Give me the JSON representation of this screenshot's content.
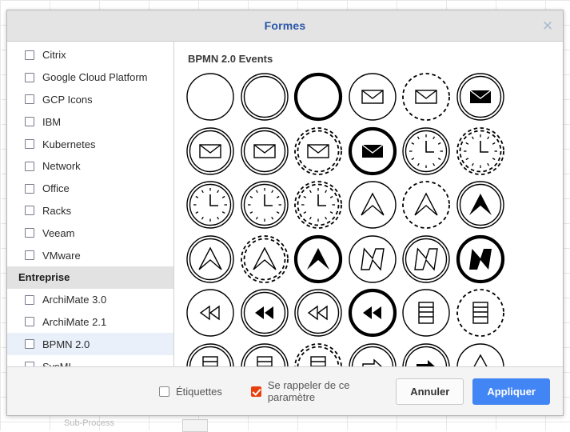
{
  "backdrop": {
    "label": "Sub-Process"
  },
  "dialog": {
    "title": "Formes",
    "close_icon": "close-icon"
  },
  "sidebar": {
    "items": [
      {
        "label": "Citrix",
        "type": "checkbox",
        "checked": false,
        "selected": false
      },
      {
        "label": "Google Cloud Platform",
        "type": "checkbox",
        "checked": false,
        "selected": false
      },
      {
        "label": "GCP Icons",
        "type": "checkbox",
        "checked": false,
        "selected": false
      },
      {
        "label": "IBM",
        "type": "checkbox",
        "checked": false,
        "selected": false
      },
      {
        "label": "Kubernetes",
        "type": "checkbox",
        "checked": false,
        "selected": false
      },
      {
        "label": "Network",
        "type": "checkbox",
        "checked": false,
        "selected": false
      },
      {
        "label": "Office",
        "type": "checkbox",
        "checked": false,
        "selected": false
      },
      {
        "label": "Racks",
        "type": "checkbox",
        "checked": false,
        "selected": false
      },
      {
        "label": "Veeam",
        "type": "checkbox",
        "checked": false,
        "selected": false
      },
      {
        "label": "VMware",
        "type": "checkbox",
        "checked": false,
        "selected": false
      },
      {
        "label": "Entreprise",
        "type": "group",
        "checked": false,
        "selected": false
      },
      {
        "label": "ArchiMate 3.0",
        "type": "checkbox",
        "checked": false,
        "selected": false
      },
      {
        "label": "ArchiMate 2.1",
        "type": "checkbox",
        "checked": false,
        "selected": false
      },
      {
        "label": "BPMN 2.0",
        "type": "checkbox",
        "checked": false,
        "selected": true
      },
      {
        "label": "SysML",
        "type": "checkbox",
        "checked": false,
        "selected": false
      }
    ]
  },
  "shapes_panel": {
    "section_title": "BPMN 2.0 Events",
    "columns": 6,
    "shapes": [
      {
        "name": "start-event",
        "ring": "single",
        "glyph": "none"
      },
      {
        "name": "start-event-non-interrupting",
        "ring": "double",
        "glyph": "none"
      },
      {
        "name": "end-event",
        "ring": "thick",
        "glyph": "none"
      },
      {
        "name": "message-start-event",
        "ring": "single",
        "glyph": "envelope"
      },
      {
        "name": "message-start-event-non-interrupting",
        "ring": "dashed",
        "glyph": "envelope"
      },
      {
        "name": "message-end-event",
        "ring": "double",
        "glyph": "envelope-filled"
      },
      {
        "name": "message-intermediate-catch-event",
        "ring": "double",
        "glyph": "envelope"
      },
      {
        "name": "message-intermediate-boundary-event",
        "ring": "double",
        "glyph": "envelope"
      },
      {
        "name": "message-boundary-non-interrupting",
        "ring": "dashed-double",
        "glyph": "envelope"
      },
      {
        "name": "message-throw-end-event",
        "ring": "thick",
        "glyph": "envelope-filled"
      },
      {
        "name": "timer-start-event",
        "ring": "double",
        "glyph": "clock"
      },
      {
        "name": "timer-start-non-interrupting",
        "ring": "dashed-double",
        "glyph": "clock"
      },
      {
        "name": "timer-intermediate-event",
        "ring": "double",
        "glyph": "clock"
      },
      {
        "name": "timer-boundary-event",
        "ring": "double",
        "glyph": "clock"
      },
      {
        "name": "timer-boundary-non-interrupting",
        "ring": "dashed-double",
        "glyph": "clock"
      },
      {
        "name": "escalation-start-event",
        "ring": "single",
        "glyph": "chevron"
      },
      {
        "name": "escalation-start-non-interrupting",
        "ring": "dashed",
        "glyph": "chevron"
      },
      {
        "name": "escalation-end-event",
        "ring": "double",
        "glyph": "chevron-filled"
      },
      {
        "name": "escalation-intermediate-event",
        "ring": "double",
        "glyph": "chevron"
      },
      {
        "name": "escalation-boundary-non-interrupting",
        "ring": "dashed-double",
        "glyph": "chevron"
      },
      {
        "name": "escalation-throw-end-event",
        "ring": "thick",
        "glyph": "chevron-filled"
      },
      {
        "name": "conditional-start-event",
        "ring": "single",
        "glyph": "zigzag"
      },
      {
        "name": "conditional-intermediate-event",
        "ring": "double",
        "glyph": "zigzag"
      },
      {
        "name": "conditional-end-event",
        "ring": "thick",
        "glyph": "zigzag-filled"
      },
      {
        "name": "link-catch-event",
        "ring": "single",
        "glyph": "rewind"
      },
      {
        "name": "link-throw-event",
        "ring": "double",
        "glyph": "rewind-filled"
      },
      {
        "name": "link-intermediate-catch-event",
        "ring": "double",
        "glyph": "rewind"
      },
      {
        "name": "link-throw-end-event",
        "ring": "thick",
        "glyph": "rewind-filled"
      },
      {
        "name": "multiple-start-event",
        "ring": "single",
        "glyph": "list"
      },
      {
        "name": "multiple-start-non-interrupting",
        "ring": "dashed",
        "glyph": "list"
      },
      {
        "name": "multiple-intermediate-event",
        "ring": "double",
        "glyph": "list"
      },
      {
        "name": "multiple-boundary-event",
        "ring": "double",
        "glyph": "list"
      },
      {
        "name": "multiple-boundary-non-interrupting",
        "ring": "dashed-double",
        "glyph": "list"
      },
      {
        "name": "signal-catch-event",
        "ring": "double",
        "glyph": "arrow"
      },
      {
        "name": "signal-throw-event",
        "ring": "double",
        "glyph": "arrow-filled"
      },
      {
        "name": "signal-start-event",
        "ring": "single",
        "glyph": "triangle"
      }
    ]
  },
  "footer": {
    "labels_checkbox": {
      "label": "Étiquettes",
      "checked": false
    },
    "remember_checkbox": {
      "label": "Se rappeler de ce paramètre",
      "checked": true
    },
    "cancel_label": "Annuler",
    "apply_label": "Appliquer",
    "accent_color": "#4285f4",
    "checked_color": "#e8400c"
  }
}
